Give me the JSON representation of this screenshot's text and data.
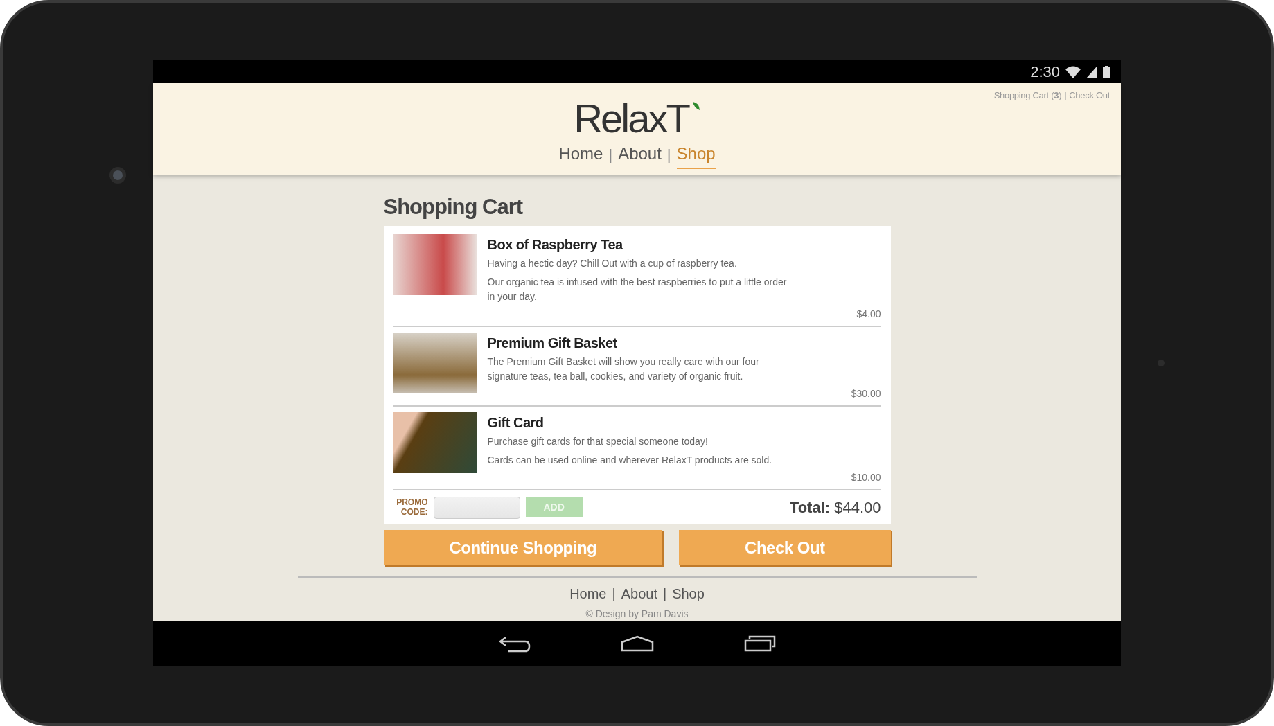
{
  "status_bar": {
    "time": "2:30"
  },
  "header": {
    "top_links": {
      "cart": "Shopping Cart (**3**)",
      "separator": "|",
      "checkout": "Check Out"
    },
    "logo": "RelaxT",
    "nav": {
      "items": [
        {
          "label": "Home",
          "selected": false
        },
        {
          "label": "About",
          "selected": false
        },
        {
          "label": "Shop",
          "selected": true
        }
      ],
      "separators": [
        "|",
        "|"
      ]
    }
  },
  "cart": {
    "title": "Shopping Cart",
    "items": [
      {
        "name": "Box of Raspberry Tea",
        "description": [
          "Having a hectic day? Chill Out with a cup of raspberry tea.",
          "Our organic tea is infused with the best raspberries to put a little order in your day."
        ],
        "price": "$4.00"
      },
      {
        "name": "Premium Gift Basket",
        "description": [
          "The Premium Gift Basket will show you really care with our four signature teas, tea ball, cookies, and variety of organic fruit."
        ],
        "price": "$30.00"
      },
      {
        "name": "Gift Card",
        "description": [
          "Purchase gift cards for that special someone today!",
          "Cards can be used online and wherever RelaxT products are sold."
        ],
        "price": "$10.00"
      }
    ],
    "promo": {
      "label": "PROMO CODE:",
      "button": "ADD",
      "disabled": true
    },
    "total": {
      "label": "Total:",
      "value": "$44.00"
    },
    "buttons": [
      "Continue Shopping",
      "Check Out"
    ]
  },
  "footer": {
    "nav": [
      "Home",
      "About",
      "Shop"
    ],
    "separators": [
      "|",
      "|"
    ],
    "copyright": "© Design by Pam Davis"
  }
}
